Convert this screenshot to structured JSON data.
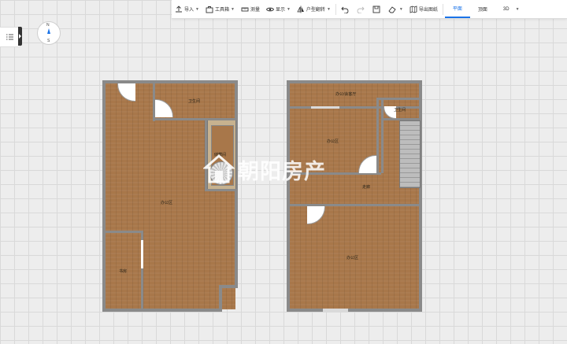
{
  "toolbar": {
    "import_label": "导入",
    "toolbox_label": "工具箱",
    "measure_label": "测量",
    "display_label": "显示",
    "flip_label": "户型翻转",
    "export_label": "导出图纸"
  },
  "views": {
    "plan": "平面",
    "top": "顶面",
    "three_d": "3D"
  },
  "compass": {
    "north": "N",
    "south": "S"
  },
  "plan_left": {
    "bathroom": "卫生间",
    "storage": "储藏间",
    "office": "办公区",
    "study": "书房"
  },
  "plan_right": {
    "office_top": "办公/会客厅",
    "bathroom": "卫生间",
    "office_mid": "办公区",
    "corridor": "走廊",
    "office_bottom": "办公区"
  },
  "watermark": {
    "text": "朝阳房产"
  },
  "colors": {
    "accent": "#1a73e8",
    "floor": "#a8774a",
    "wall": "#8a8a8a"
  }
}
